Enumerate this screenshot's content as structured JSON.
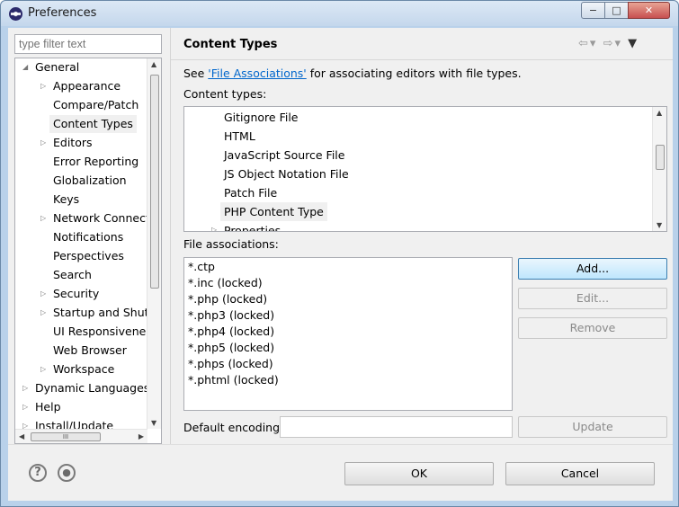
{
  "window": {
    "title": "Preferences"
  },
  "filter": {
    "placeholder": "type filter text"
  },
  "tree": {
    "items": [
      {
        "label": "General",
        "expander": "expanded"
      },
      {
        "label": "Appearance",
        "expander": "collapsed"
      },
      {
        "label": "Compare/Patch",
        "expander": ""
      },
      {
        "label": "Content Types",
        "expander": "",
        "selected": true
      },
      {
        "label": "Editors",
        "expander": "collapsed"
      },
      {
        "label": "Error Reporting",
        "expander": ""
      },
      {
        "label": "Globalization",
        "expander": ""
      },
      {
        "label": "Keys",
        "expander": ""
      },
      {
        "label": "Network Connecti",
        "expander": "collapsed"
      },
      {
        "label": "Notifications",
        "expander": ""
      },
      {
        "label": "Perspectives",
        "expander": ""
      },
      {
        "label": "Search",
        "expander": ""
      },
      {
        "label": "Security",
        "expander": "collapsed"
      },
      {
        "label": "Startup and Shutd",
        "expander": "collapsed"
      },
      {
        "label": "UI Responsivenes",
        "expander": ""
      },
      {
        "label": "Web Browser",
        "expander": ""
      },
      {
        "label": "Workspace",
        "expander": "collapsed"
      },
      {
        "label": "Dynamic Languages",
        "expander": "collapsed"
      },
      {
        "label": "Help",
        "expander": "collapsed"
      },
      {
        "label": "Install/Update",
        "expander": "collapsed"
      }
    ],
    "hscroll_grip": "III"
  },
  "page": {
    "title": "Content Types",
    "see_prefix": "See ",
    "see_link": "'File Associations'",
    "see_suffix": " for associating editors with file types.",
    "content_types_label": "Content types:",
    "content_types": [
      "Gitignore File",
      "HTML",
      "JavaScript Source File",
      "JS Object Notation File",
      "Patch File",
      "PHP Content Type",
      "Properties"
    ],
    "selected_content_type": "PHP Content Type",
    "file_associations_label": "File associations:",
    "file_associations": [
      "*.ctp",
      "*.inc (locked)",
      "*.php (locked)",
      "*.php3 (locked)",
      "*.php4 (locked)",
      "*.php5 (locked)",
      "*.phps (locked)",
      "*.phtml (locked)"
    ],
    "add_label": "Add...",
    "edit_label": "Edit...",
    "remove_label": "Remove",
    "default_encoding_label": "Default encoding:",
    "default_encoding_value": "",
    "update_label": "Update"
  },
  "footer": {
    "ok_label": "OK",
    "cancel_label": "Cancel",
    "help_glyph": "?",
    "oomph_glyph": "●"
  },
  "window_buttons": {
    "minimize": "−",
    "maximize": "□",
    "close": "✕"
  },
  "nav": {
    "back": "⇦",
    "forward": "⇨",
    "dropdown": "▾",
    "menu": "▼"
  }
}
